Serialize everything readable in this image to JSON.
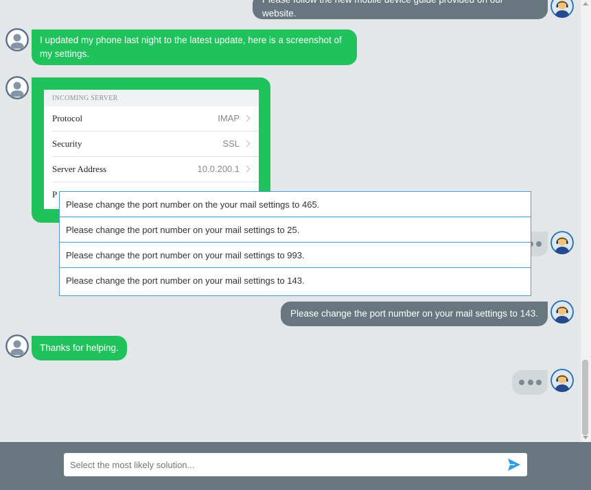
{
  "conversation": {
    "messages": [
      {
        "sender": "agent",
        "style": "grey",
        "text": "Please follow the new mobile device guide provided on our website."
      },
      {
        "sender": "customer",
        "style": "green",
        "text": "I updated my phone last night to the latest update, here is a screenshot of my settings."
      },
      {
        "sender": "customer",
        "style": "image",
        "text": ""
      },
      {
        "sender": "agent",
        "style": "typing",
        "text": ""
      },
      {
        "sender": "agent",
        "style": "grey",
        "text": "Please change the port number on your mail settings to 143."
      },
      {
        "sender": "customer",
        "style": "green",
        "text": "Thanks for helping."
      },
      {
        "sender": "agent",
        "style": "typing",
        "text": ""
      }
    ]
  },
  "screenshot": {
    "section_header": "INCOMING SERVER",
    "rows": [
      {
        "label": "Protocol",
        "value": "IMAP"
      },
      {
        "label": "Security",
        "value": "SSL"
      },
      {
        "label": "Server Address",
        "value": "10.0.200.1"
      },
      {
        "label": "P",
        "value": ""
      }
    ]
  },
  "options": [
    "Please change the port number on the your mail settings to 465.",
    "Please change the port number on your mail settings to 25.",
    "Please change the port number on your mail settings to 993.",
    "Please change the port number on your mail settings to 143."
  ],
  "input": {
    "placeholder": "Select the most likely solution...",
    "value": ""
  },
  "icons": {
    "send": "send-arrow-icon",
    "customer_avatar": "user-silhouette-icon",
    "agent_avatar": "agent-headset-icon"
  },
  "colors": {
    "chat_background": "#e3e7ea",
    "agent_bubble": "#68777f",
    "customer_bubble": "#20c25b",
    "typing_bubble": "#d2d7da",
    "option_border": "#4a9ad4",
    "send_icon": "#2d9ee0",
    "footer": "#68777f"
  }
}
